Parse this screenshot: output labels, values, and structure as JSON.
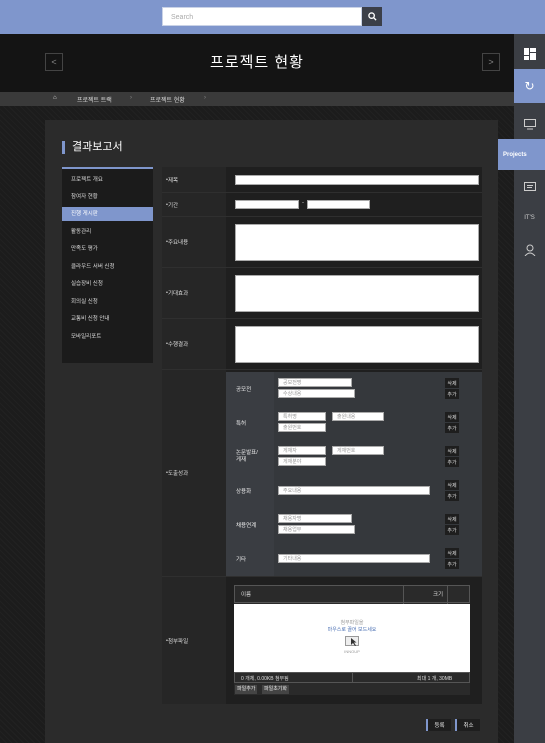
{
  "search": {
    "placeholder": "Search"
  },
  "header": {
    "title": "프로젝트 현황"
  },
  "breadcrumb": {
    "items": [
      "프로젝트 트랙",
      "프로젝트 현황"
    ]
  },
  "right_sidebar": {
    "projects_label": "Projects",
    "its_label": "IT'S"
  },
  "section_title": "결과보고서",
  "left_nav": [
    "프로젝트 개요",
    "참여자 현황",
    "진행 게시판",
    "활동관리",
    "만족도 평가",
    "클라우드 서버 신청",
    "실습장비 신청",
    "회의실 신청",
    "교통비 신청 안내",
    "모바일리포트"
  ],
  "left_nav_active": "진행 게시판",
  "form": {
    "title_label": "제목",
    "period_label": "기간",
    "period_sep": "-",
    "content_label": "주요내용",
    "expect_label": "기대효과",
    "result_label": "수행결과",
    "output_label": "도출성과",
    "outputs": [
      {
        "label": "공모전",
        "fields": [
          "공모전명",
          "수상내용"
        ]
      },
      {
        "label": "특허",
        "fields": [
          "특허명",
          "출원내용",
          "출원번호"
        ]
      },
      {
        "label": "논문발표/\n게재",
        "fields": [
          "게재자",
          "게재번호",
          "게재분야"
        ]
      },
      {
        "label": "상용화",
        "fields": [
          "주요내용"
        ]
      },
      {
        "label": "채용연계",
        "fields": [
          "채용자명",
          "채용업무"
        ]
      },
      {
        "label": "기타",
        "fields": [
          "기타내용"
        ]
      }
    ],
    "delete_label": "삭제",
    "add_label": "추가",
    "attach_label": "첨부파일",
    "attach": {
      "col_name": "이름",
      "col_size": "크기",
      "drop_line1": "첨부파일을",
      "drop_line2": "마우스로 끌어 보드세요",
      "logo_text": "INNOUP",
      "status": "0 개체, 0.00KB 첨부됨",
      "limit": "최대 1 개, 30MB",
      "add_file": "파일추가",
      "reset_file": "파일초기화"
    }
  },
  "buttons": {
    "register": "등록",
    "cancel": "취소"
  }
}
